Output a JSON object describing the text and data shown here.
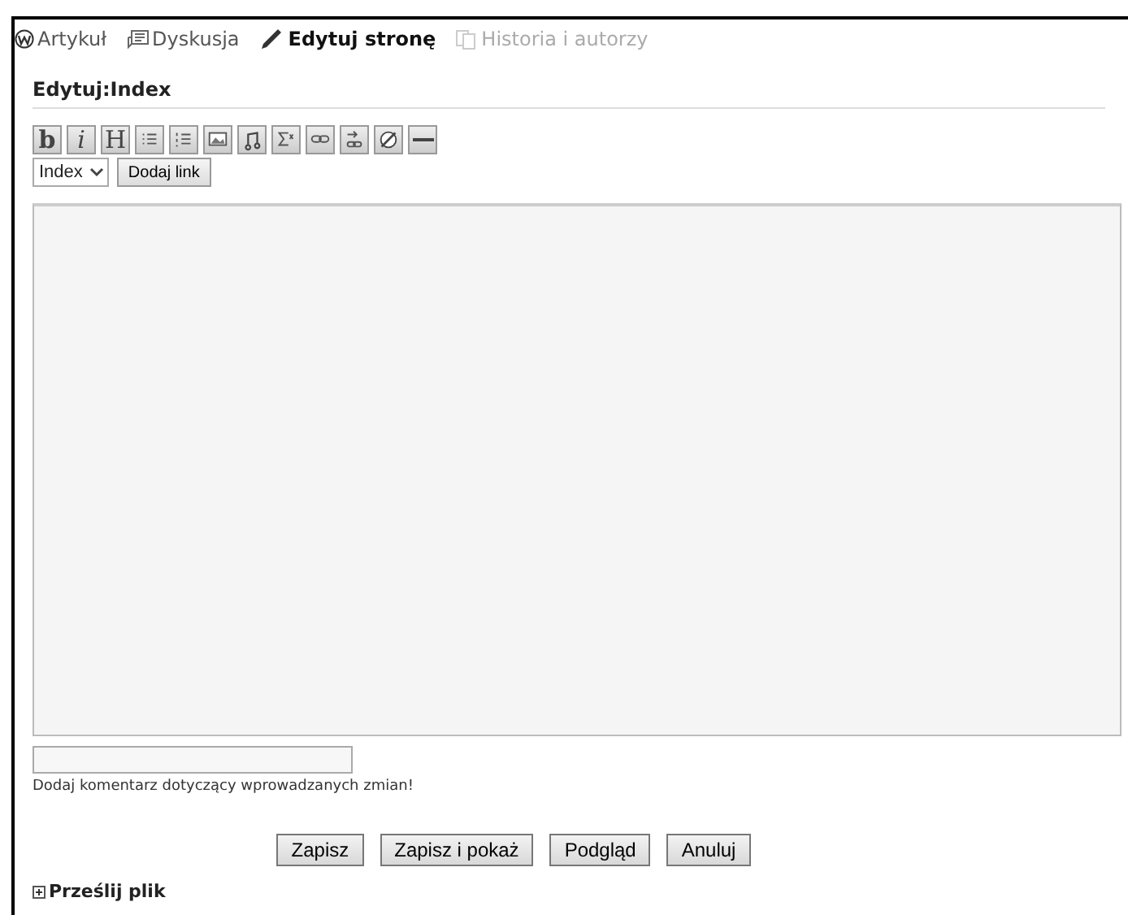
{
  "tabs": [
    {
      "label": "Artykuł",
      "selected": false,
      "disabled": false
    },
    {
      "label": "Dyskusja",
      "selected": false,
      "disabled": false
    },
    {
      "label": "Edytuj stronę",
      "selected": true,
      "disabled": false
    },
    {
      "label": "Historia i autorzy",
      "selected": false,
      "disabled": true
    }
  ],
  "heading": "Edytuj:Index",
  "format_buttons": [
    "b",
    "i",
    "H"
  ],
  "link_select": {
    "value": "Index"
  },
  "add_link_button": "Dodaj link",
  "summary_hint": "Dodaj komentarz dotyczący wprowadzanych zmian!",
  "actions": [
    "Zapisz",
    "Zapisz i pokaż",
    "Podgląd",
    "Anuluj"
  ],
  "upload_section": {
    "label": "Prześlij plik",
    "expanded": false
  }
}
